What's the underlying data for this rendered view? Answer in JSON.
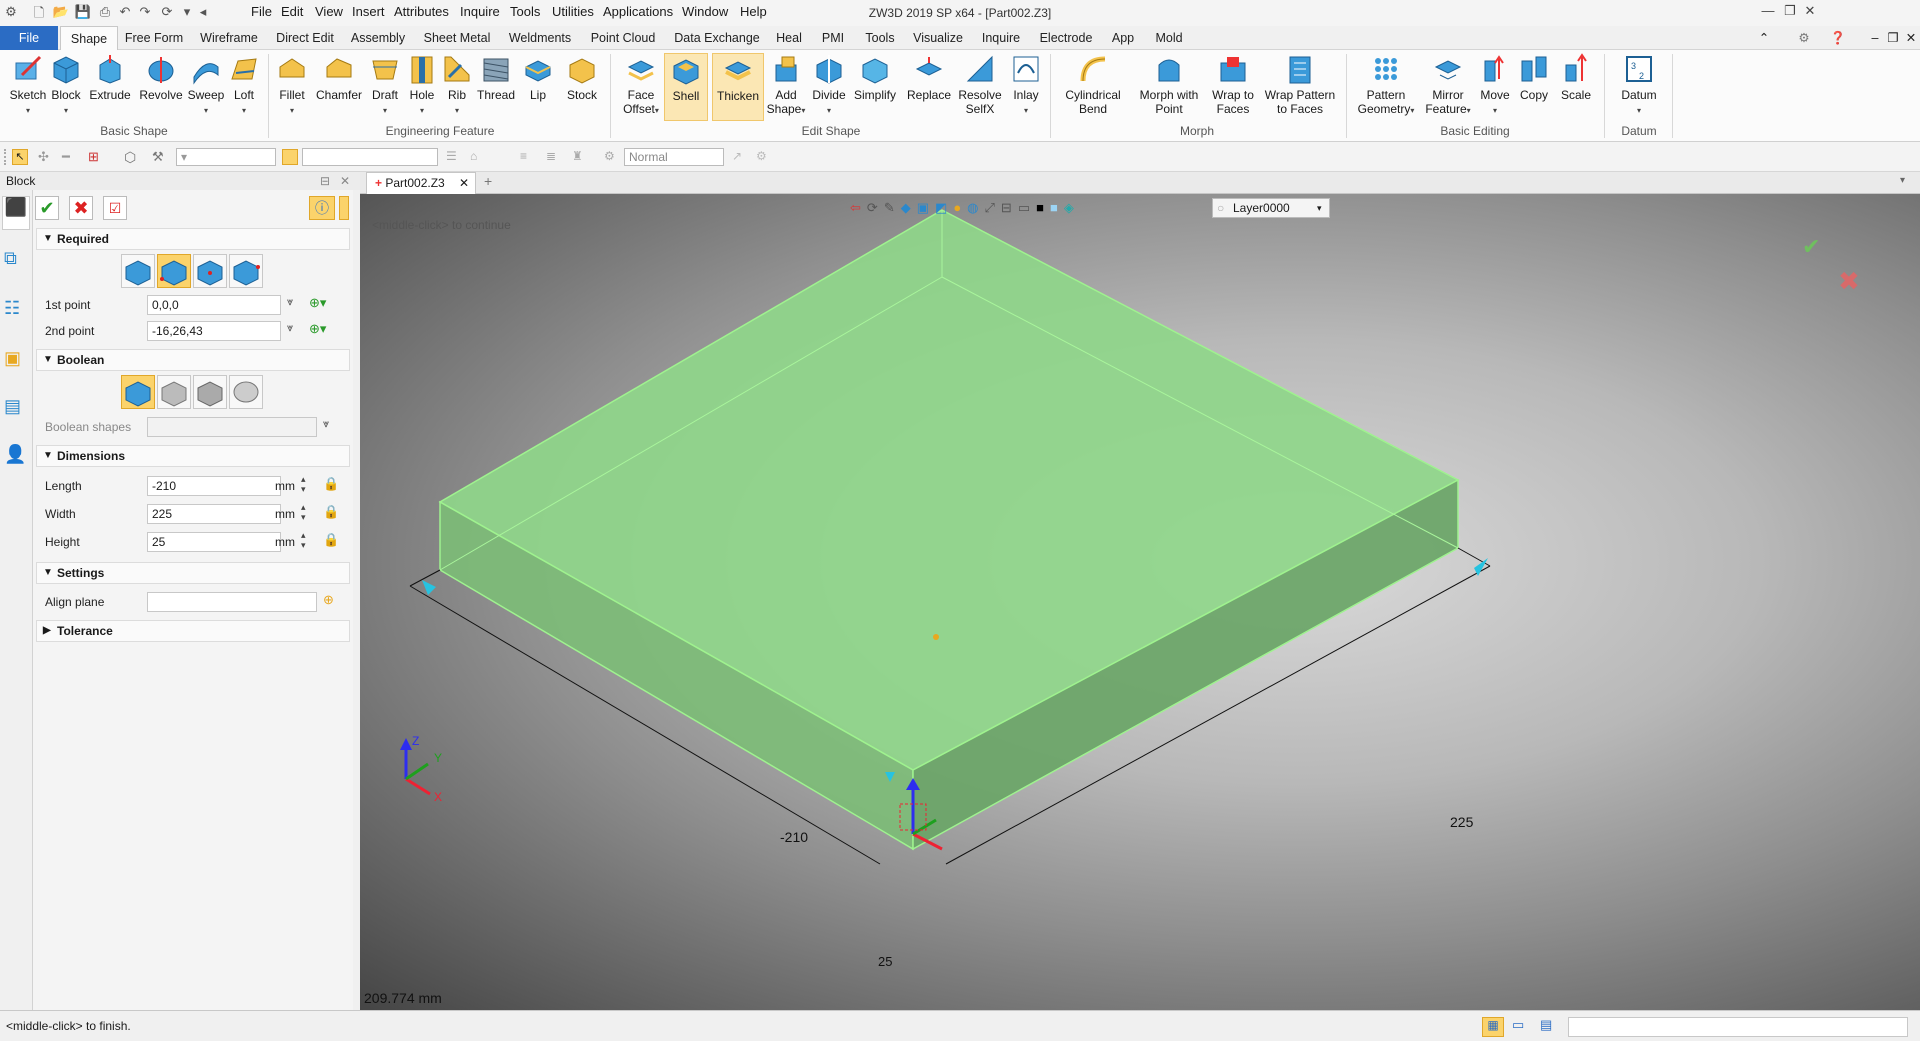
{
  "window": {
    "title": "ZW3D 2019 SP x64 - [Part002.Z3]",
    "menu": [
      "File",
      "Edit",
      "View",
      "Insert",
      "Attributes",
      "Inquire",
      "Tools",
      "Utilities",
      "Applications",
      "Window",
      "Help"
    ]
  },
  "ribbon_tabs": [
    "File",
    "Shape",
    "Free Form",
    "Wireframe",
    "Direct Edit",
    "Assembly",
    "Sheet Metal",
    "Weldments",
    "Point Cloud",
    "Data Exchange",
    "Heal",
    "PMI",
    "Tools",
    "Visualize",
    "Inquire",
    "Electrode",
    "App",
    "Mold"
  ],
  "active_tab": "Shape",
  "ribbon": {
    "basic_shape": {
      "label": "Basic Shape",
      "buttons": [
        "Sketch",
        "Block",
        "Extrude",
        "Revolve",
        "Sweep",
        "Loft"
      ]
    },
    "engineering_feature": {
      "label": "Engineering Feature",
      "buttons": [
        "Fillet",
        "Chamfer",
        "Draft",
        "Hole",
        "Rib",
        "Thread",
        "Lip",
        "Stock"
      ]
    },
    "edit_shape": {
      "label": "Edit Shape",
      "buttons": [
        "Face\nOffset",
        "Shell",
        "Thicken",
        "Add\nShape",
        "Divide",
        "Simplify",
        "Replace",
        "Resolve\nSelfX",
        "Inlay"
      ]
    },
    "morph": {
      "label": "Morph",
      "buttons": [
        "Cylindrical\nBend",
        "Morph with\nPoint",
        "Wrap to\nFaces",
        "Wrap Pattern\nto Faces"
      ]
    },
    "basic_editing": {
      "label": "Basic Editing",
      "buttons": [
        "Pattern\nGeometry",
        "Mirror\nFeature",
        "Move",
        "Copy",
        "Scale"
      ]
    },
    "datum": {
      "label": "Datum",
      "buttons": [
        "Datum"
      ]
    }
  },
  "toolbar2": {
    "render_mode": "Normal"
  },
  "panel": {
    "title": "Block",
    "required": {
      "header": "Required",
      "first_point_label": "1st point",
      "first_point_value": "0,0,0",
      "second_point_label": "2nd point",
      "second_point_value": "-16,26,43"
    },
    "boolean": {
      "header": "Boolean",
      "shapes_label": "Boolean shapes"
    },
    "dimensions": {
      "header": "Dimensions",
      "length_label": "Length",
      "length_value": "-210",
      "width_label": "Width",
      "width_value": "225",
      "height_label": "Height",
      "height_value": "25",
      "unit": "mm"
    },
    "settings": {
      "header": "Settings",
      "align_plane_label": "Align plane"
    },
    "tolerance": {
      "header": "Tolerance"
    }
  },
  "document_tab": "Part002.Z3",
  "viewport": {
    "prompt": "<middle-click> to continue",
    "layer": "Layer0000",
    "dim_length": "-210",
    "dim_width": "225",
    "dim_height": "25",
    "readout": "209.774 mm",
    "axis_x": "X",
    "axis_y": "Y",
    "axis_z": "Z"
  },
  "status": {
    "text": "<middle-click> to finish."
  },
  "colors": {
    "accent": "#2b6cc4",
    "block_fill": "#8fd68a",
    "block_edge": "#9ff28f",
    "selected_button": "#fbd36b"
  }
}
